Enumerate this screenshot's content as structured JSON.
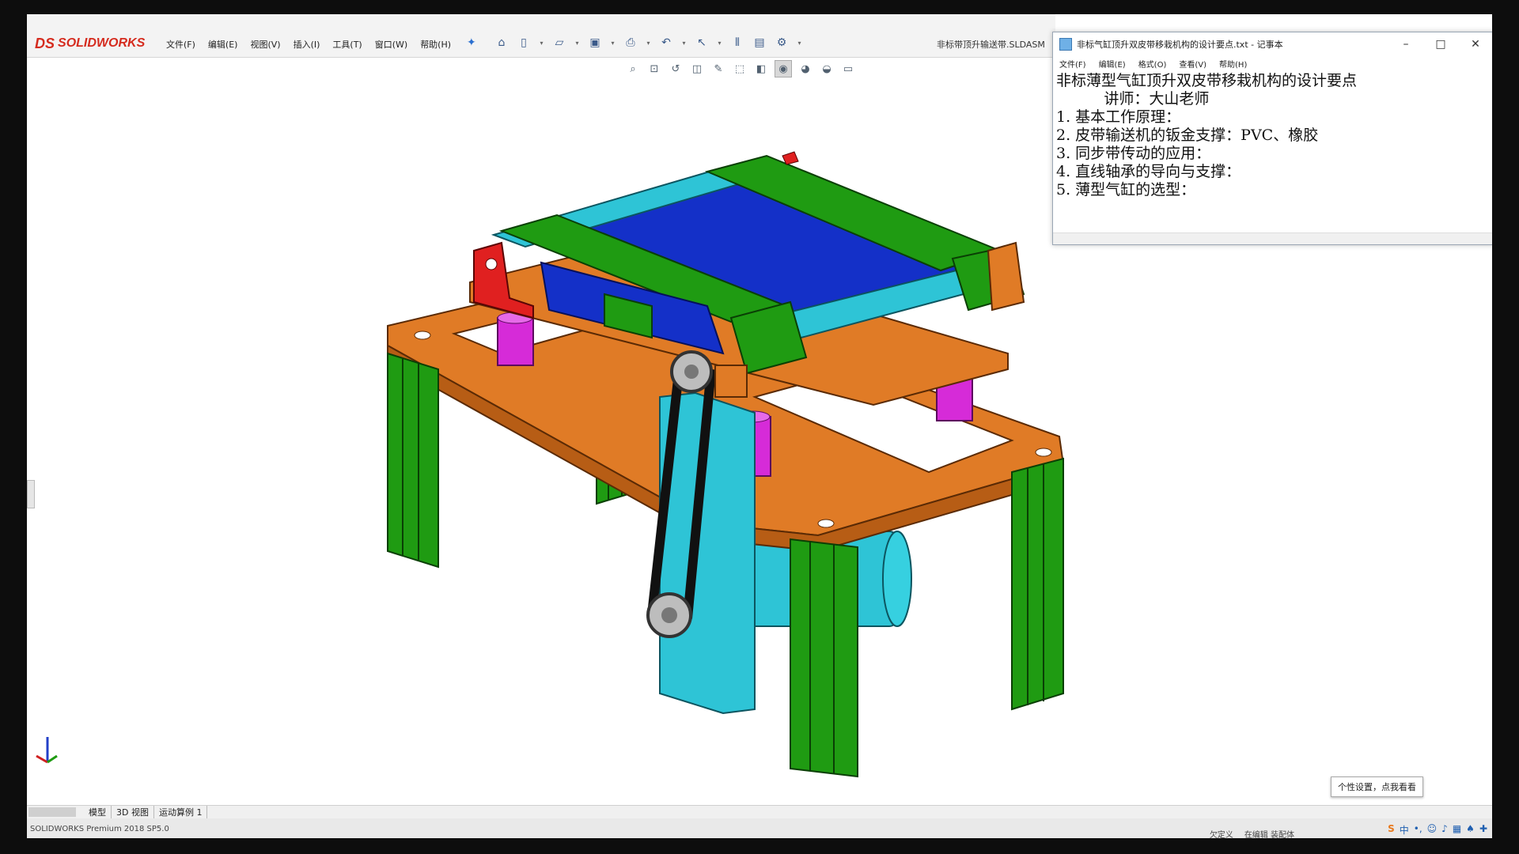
{
  "app": {
    "logo_ds": "DS",
    "logo_text": "SOLIDWORKS"
  },
  "menu": [
    "文件(F)",
    "编辑(E)",
    "视图(V)",
    "插入(I)",
    "工具(T)",
    "窗口(W)",
    "帮助(H)"
  ],
  "document_title": "非标带顶升输送带.SLDASM",
  "notepad": {
    "title": "非标气缸顶升双皮带移栽机构的设计要点.txt - 记事本",
    "menu": [
      "文件(F)",
      "编辑(E)",
      "格式(O)",
      "查看(V)",
      "帮助(H)"
    ],
    "lines": [
      "非标薄型气缸顶升双皮带移栽机构的设计要点",
      "          讲师：大山老师",
      "1. 基本工作原理：",
      "2. 皮带输送机的钣金支撑：PVC、橡胶",
      "3. 同步带传动的应用：",
      "4. 直线轴承的导向与支撑：",
      "5. 薄型气缸的选型："
    ]
  },
  "tabs": [
    "模型",
    "3D 视图",
    "运动算例 1"
  ],
  "status_left": "SOLIDWORKS Premium 2018 SP5.0",
  "status_right": [
    "欠定义",
    "在编辑 装配体"
  ],
  "tooltip": "个性设置，点我看看",
  "colors": {
    "frame_green": "#1f9b12",
    "plate_orange": "#e07b26",
    "roller_cyan": "#2ec4d6",
    "belt_blue": "#1430c8",
    "cylinder_magenta": "#d62bd8",
    "bracket_red": "#e02020"
  }
}
